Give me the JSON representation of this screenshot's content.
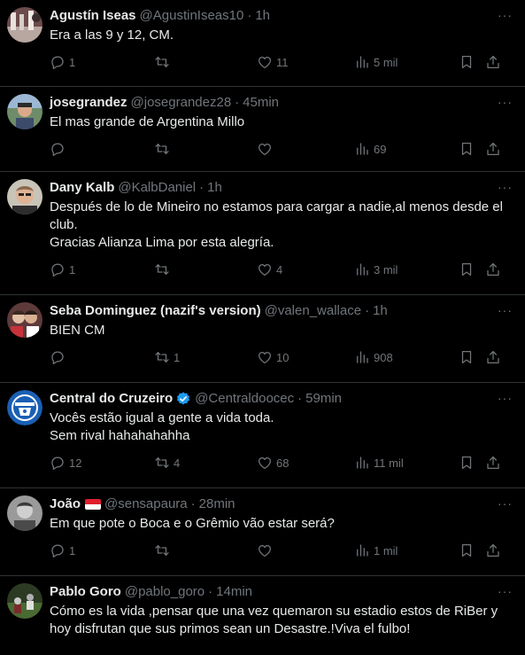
{
  "colors": {
    "background": "#000000",
    "text": "#e7e9ea",
    "muted": "#71767b",
    "border": "#2f3336",
    "verified": "#1d9bf0"
  },
  "icons": [
    "more-icon",
    "reply-icon",
    "retweet-icon",
    "like-icon",
    "views-icon",
    "bookmark-icon",
    "share-icon",
    "verified-icon",
    "flag-icon"
  ],
  "tweets": [
    {
      "name": "Agustín Iseas",
      "handle": "@AgustinIseas10",
      "time": "1h",
      "text": "Era a las 9 y 12, CM.",
      "replies": "1",
      "retweets": "",
      "likes": "11",
      "views": "5 mil"
    },
    {
      "name": "josegrandez",
      "handle": "@josegrandez28",
      "time": "45min",
      "text": "El mas grande de Argentina Millo",
      "replies": "",
      "retweets": "",
      "likes": "",
      "views": "69"
    },
    {
      "name": "Dany Kalb",
      "handle": "@KalbDaniel",
      "time": "1h",
      "text": "Después de lo de Mineiro no estamos para cargar a nadie,al menos desde el club.\nGracias Alianza Lima por esta alegría.",
      "replies": "1",
      "retweets": "",
      "likes": "4",
      "views": "3 mil"
    },
    {
      "name": "Seba Dominguez (nazif's version)",
      "handle": "@valen_wallace",
      "time": "1h",
      "text": "BIEN CM",
      "replies": "",
      "retweets": "1",
      "likes": "10",
      "views": "908"
    },
    {
      "name": "Central do Cruzeiro",
      "handle": "@Centraldoocec",
      "time": "59min",
      "text": "Vocês estão igual a gente a vida toda.\nSem rival hahahahahha",
      "replies": "12",
      "retweets": "4",
      "likes": "68",
      "views": "11 mil"
    },
    {
      "name": "João",
      "handle": "@sensapaura",
      "time": "28min",
      "text": "Em que pote o Boca e o Grêmio vão estar será?",
      "replies": "1",
      "retweets": "",
      "likes": "",
      "views": "1 mil"
    },
    {
      "name": "Pablo Goro",
      "handle": "@pablo_goro",
      "time": "14min",
      "text": "Cómo es la vida ,pensar que una vez quemaron su estadio estos de RiBer y hoy disfrutan que sus primos sean un Desastre.!Viva el fulbo!",
      "replies": "",
      "retweets": "",
      "likes": "",
      "views": ""
    }
  ]
}
